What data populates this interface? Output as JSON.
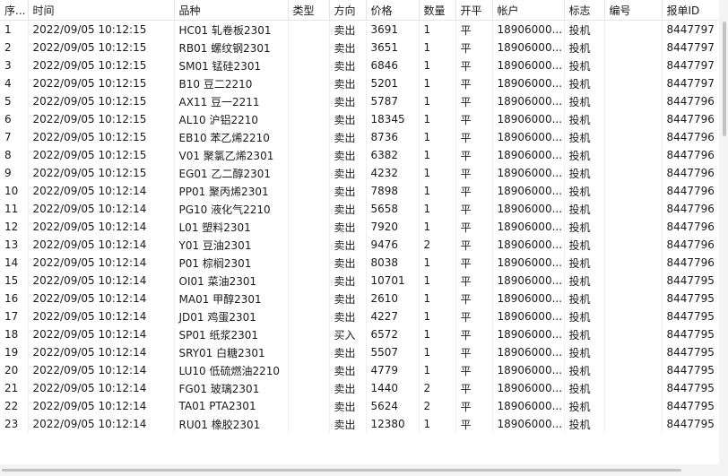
{
  "columns": [
    "序...",
    "时间",
    "品种",
    "类型",
    "方向",
    "价格",
    "数量",
    "开平",
    "帐户",
    "标志",
    "编号",
    "报单ID"
  ],
  "rows": [
    [
      "1",
      "2022/09/05 10:12:15",
      "HC01 轧卷板2301",
      "",
      "卖出",
      "3691",
      "1",
      "平",
      "18906000...",
      "投机",
      "",
      "8447797"
    ],
    [
      "2",
      "2022/09/05 10:12:15",
      "RB01 螺纹钢2301",
      "",
      "卖出",
      "3651",
      "1",
      "平",
      "18906000...",
      "投机",
      "",
      "8447797"
    ],
    [
      "3",
      "2022/09/05 10:12:15",
      "SM01 锰硅2301",
      "",
      "卖出",
      "6846",
      "1",
      "平",
      "18906000...",
      "投机",
      "",
      "8447797"
    ],
    [
      "4",
      "2022/09/05 10:12:15",
      "B10 豆二2210",
      "",
      "卖出",
      "5201",
      "1",
      "平",
      "18906000...",
      "投机",
      "",
      "8447797"
    ],
    [
      "5",
      "2022/09/05 10:12:15",
      "AX11 豆一2211",
      "",
      "卖出",
      "5787",
      "1",
      "平",
      "18906000...",
      "投机",
      "",
      "8447796"
    ],
    [
      "6",
      "2022/09/05 10:12:15",
      "AL10 沪铝2210",
      "",
      "卖出",
      "18345",
      "1",
      "平",
      "18906000...",
      "投机",
      "",
      "8447796"
    ],
    [
      "7",
      "2022/09/05 10:12:15",
      "EB10 苯乙烯2210",
      "",
      "卖出",
      "8736",
      "1",
      "平",
      "18906000...",
      "投机",
      "",
      "8447796"
    ],
    [
      "8",
      "2022/09/05 10:12:15",
      "V01 聚氯乙烯2301",
      "",
      "卖出",
      "6382",
      "1",
      "平",
      "18906000...",
      "投机",
      "",
      "8447796"
    ],
    [
      "9",
      "2022/09/05 10:12:15",
      "EG01 乙二醇2301",
      "",
      "卖出",
      "4232",
      "1",
      "平",
      "18906000...",
      "投机",
      "",
      "8447796"
    ],
    [
      "10",
      "2022/09/05 10:12:14",
      "PP01 聚丙烯2301",
      "",
      "卖出",
      "7898",
      "1",
      "平",
      "18906000...",
      "投机",
      "",
      "8447796"
    ],
    [
      "11",
      "2022/09/05 10:12:14",
      "PG10 液化气2210",
      "",
      "卖出",
      "5658",
      "1",
      "平",
      "18906000...",
      "投机",
      "",
      "8447796"
    ],
    [
      "12",
      "2022/09/05 10:12:14",
      "L01 塑料2301",
      "",
      "卖出",
      "7920",
      "1",
      "平",
      "18906000...",
      "投机",
      "",
      "8447796"
    ],
    [
      "13",
      "2022/09/05 10:12:14",
      "Y01 豆油2301",
      "",
      "卖出",
      "9476",
      "2",
      "平",
      "18906000...",
      "投机",
      "",
      "8447796"
    ],
    [
      "14",
      "2022/09/05 10:12:14",
      "P01 棕榈2301",
      "",
      "卖出",
      "8038",
      "1",
      "平",
      "18906000...",
      "投机",
      "",
      "8447796"
    ],
    [
      "15",
      "2022/09/05 10:12:14",
      "OI01 菜油2301",
      "",
      "卖出",
      "10701",
      "1",
      "平",
      "18906000...",
      "投机",
      "",
      "8447795"
    ],
    [
      "16",
      "2022/09/05 10:12:14",
      "MA01 甲醇2301",
      "",
      "卖出",
      "2610",
      "1",
      "平",
      "18906000...",
      "投机",
      "",
      "8447795"
    ],
    [
      "17",
      "2022/09/05 10:12:14",
      "JD01 鸡蛋2301",
      "",
      "卖出",
      "4227",
      "1",
      "平",
      "18906000...",
      "投机",
      "",
      "8447795"
    ],
    [
      "18",
      "2022/09/05 10:12:14",
      "SP01 纸浆2301",
      "",
      "买入",
      "6572",
      "1",
      "平",
      "18906000...",
      "投机",
      "",
      "8447795"
    ],
    [
      "19",
      "2022/09/05 10:12:14",
      "SRY01 白糖2301",
      "",
      "卖出",
      "5507",
      "1",
      "平",
      "18906000...",
      "投机",
      "",
      "8447795"
    ],
    [
      "20",
      "2022/09/05 10:12:14",
      "LU10 低硫燃油2210",
      "",
      "卖出",
      "4779",
      "1",
      "平",
      "18906000...",
      "投机",
      "",
      "8447795"
    ],
    [
      "21",
      "2022/09/05 10:12:14",
      "FG01 玻璃2301",
      "",
      "卖出",
      "1440",
      "2",
      "平",
      "18906000...",
      "投机",
      "",
      "8447795"
    ],
    [
      "22",
      "2022/09/05 10:12:14",
      "TA01 PTA2301",
      "",
      "卖出",
      "5624",
      "2",
      "平",
      "18906000...",
      "投机",
      "",
      "8447795"
    ],
    [
      "23",
      "2022/09/05 10:12:14",
      "RU01 橡胶2301",
      "",
      "卖出",
      "12380",
      "1",
      "平",
      "18906000...",
      "投机",
      "",
      "8447795"
    ]
  ]
}
